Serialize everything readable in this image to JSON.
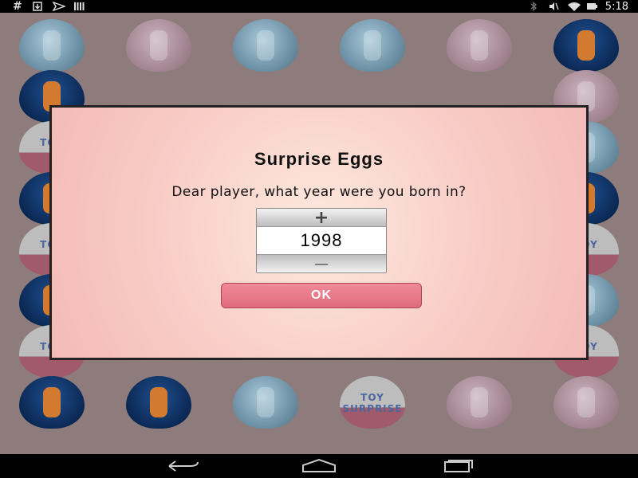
{
  "status_bar": {
    "left_icons": [
      "hash-icon",
      "download-icon",
      "send-icon",
      "signal-bars-icon"
    ],
    "right_icons": [
      "bluetooth-icon",
      "mute-icon",
      "wifi-icon",
      "battery-icon"
    ],
    "time": "5:18"
  },
  "board": {
    "eggs": [
      {
        "kind": "ice"
      },
      {
        "kind": "pink"
      },
      {
        "kind": "ice"
      },
      {
        "kind": "ice"
      },
      {
        "kind": "pink"
      },
      {
        "kind": "blue"
      },
      {
        "kind": "blue"
      },
      {
        "kind": "pink"
      },
      {
        "kind": "toy",
        "label": "TOY"
      },
      {
        "kind": "ice"
      },
      {
        "kind": "blue"
      },
      {
        "kind": "blue"
      },
      {
        "kind": "toy",
        "label": "TOY"
      },
      {
        "kind": "toy",
        "label": "TOY"
      },
      {
        "kind": "blue"
      },
      {
        "kind": "ice"
      },
      {
        "kind": "toy",
        "label": "TOY"
      },
      {
        "kind": "toy",
        "label": "TOY"
      },
      {
        "kind": "blue"
      },
      {
        "kind": "blue"
      },
      {
        "kind": "ice"
      },
      {
        "kind": "toy",
        "label": "TOY SURPRISE"
      },
      {
        "kind": "pink"
      },
      {
        "kind": "pink"
      }
    ]
  },
  "dialog": {
    "title": "Surprise Eggs",
    "question": "Dear player, what year were you born in?",
    "picker": {
      "increment_label": "+",
      "value": "1998",
      "decrement_label": "—"
    },
    "ok_label": "OK"
  },
  "nav_bar": {
    "buttons": [
      "back-icon",
      "home-icon",
      "recents-icon"
    ]
  },
  "colors": {
    "dialog_bg": "#f8cac4",
    "ok_button": "#e06b7d",
    "status_bar": "#000000"
  }
}
